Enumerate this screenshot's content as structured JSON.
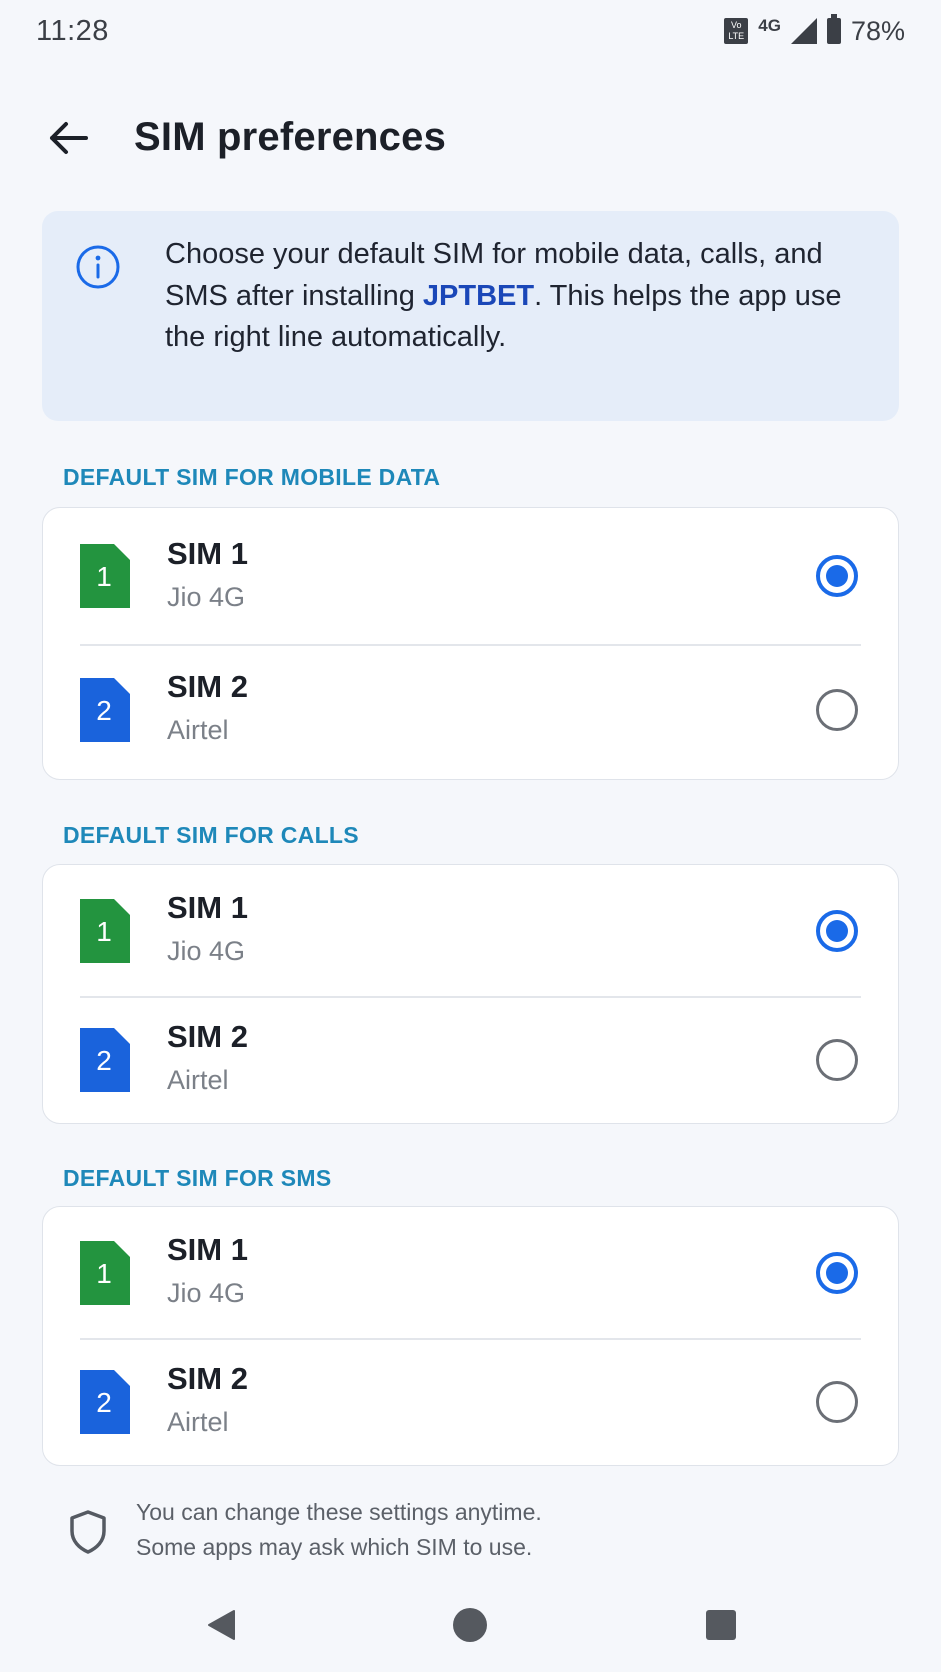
{
  "status_bar": {
    "time": "11:28",
    "volte_top": "Vo",
    "volte_bottom": "LTE",
    "network": "4G",
    "battery": "78%"
  },
  "header": {
    "title": "SIM preferences",
    "back_icon": "arrow-left-icon"
  },
  "info": {
    "icon": "info-icon",
    "text_before": "Choose your default SIM for mobile data, calls, and SMS after installing ",
    "brand": "JPTBET",
    "text_after": ". This helps the app use the right line automatically."
  },
  "sections": [
    {
      "label": "DEFAULT SIM FOR MOBILE DATA",
      "options": [
        {
          "badge": "1",
          "name": "SIM 1",
          "carrier": "Jio 4G",
          "selected": true,
          "color": "#23943f"
        },
        {
          "badge": "2",
          "name": "SIM 2",
          "carrier": "Airtel",
          "selected": false,
          "color": "#1a63dc"
        }
      ]
    },
    {
      "label": "DEFAULT SIM FOR CALLS",
      "options": [
        {
          "badge": "1",
          "name": "SIM 1",
          "carrier": "Jio 4G",
          "selected": true,
          "color": "#23943f"
        },
        {
          "badge": "2",
          "name": "SIM 2",
          "carrier": "Airtel",
          "selected": false,
          "color": "#1a63dc"
        }
      ]
    },
    {
      "label": "DEFAULT SIM FOR SMS",
      "options": [
        {
          "badge": "1",
          "name": "SIM 1",
          "carrier": "Jio 4G",
          "selected": true,
          "color": "#23943f"
        },
        {
          "badge": "2",
          "name": "SIM 2",
          "carrier": "Airtel",
          "selected": false,
          "color": "#1a63dc"
        }
      ]
    }
  ],
  "footer": {
    "icon": "shield-icon",
    "line1": "You can change these settings anytime.",
    "line2": "Some apps may ask which SIM to use."
  },
  "nav": {
    "back": "nav-back-icon",
    "home": "nav-home-icon",
    "recents": "nav-recents-icon"
  },
  "colors": {
    "accent": "#1a6ae8",
    "section_label": "#1e88b9",
    "info_bg": "#e5edf9",
    "sim1": "#23943f",
    "sim2": "#1a63dc"
  }
}
